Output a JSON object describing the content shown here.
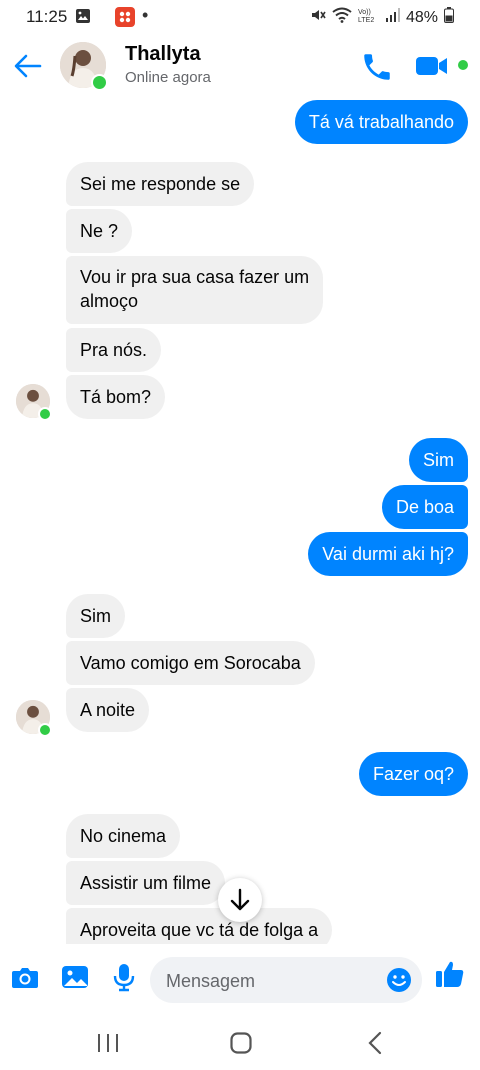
{
  "status_bar": {
    "time": "11:25",
    "battery": "48%",
    "dot": "•"
  },
  "header": {
    "name": "Thallyta",
    "status": "Online agora"
  },
  "messages": [
    {
      "text": "Tá vá trabalhando"
    },
    {
      "text": "Sei me responde se"
    },
    {
      "text": "Ne ?"
    },
    {
      "text": "Vou ir pra sua casa fazer um"
    },
    {
      "text": "almoço"
    },
    {
      "text": "Pra nós."
    },
    {
      "text": "Tá bom?"
    },
    {
      "text": "Sim"
    },
    {
      "text": "De boa"
    },
    {
      "text": "Vai durmi aki hj?"
    },
    {
      "text": "Sim"
    },
    {
      "text": "Vamo comigo em Sorocaba"
    },
    {
      "text": "A noite"
    },
    {
      "text": "Fazer oq?"
    },
    {
      "text": "No cinema"
    },
    {
      "text": "Assistir um filme"
    },
    {
      "text": "Aproveita que vc tá de folga a"
    }
  ],
  "composer": {
    "placeholder": "Mensagem"
  },
  "colors": {
    "accent": "#0084ff",
    "online": "#31cc46",
    "incoming": "#f0f0f0"
  },
  "icons": [
    "back-arrow-icon",
    "phone-icon",
    "video-icon",
    "camera-icon",
    "gallery-icon",
    "microphone-icon",
    "emoji-icon",
    "thumbs-up-icon",
    "arrow-down-icon",
    "recent-apps-icon",
    "home-icon",
    "nav-back-icon"
  ]
}
